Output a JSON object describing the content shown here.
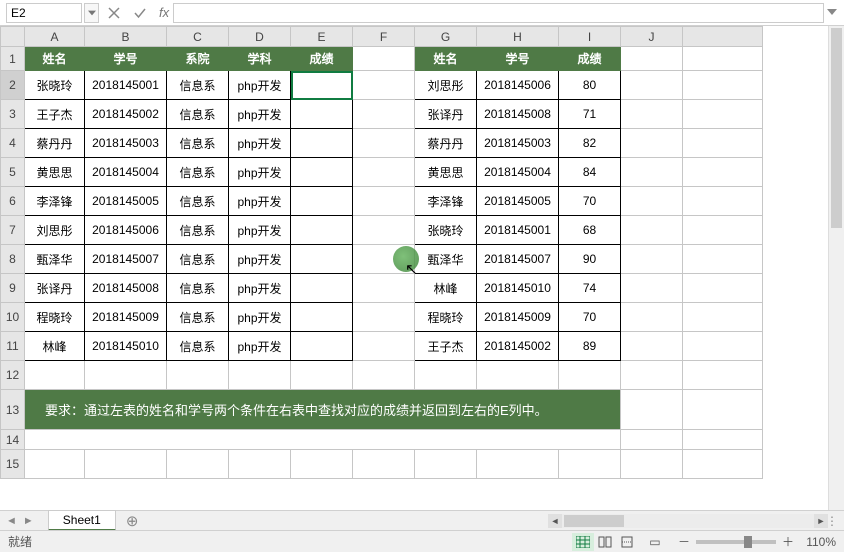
{
  "namebox": {
    "value": "E2"
  },
  "formula_bar": {
    "value": ""
  },
  "columns": [
    "A",
    "B",
    "C",
    "D",
    "E",
    "F",
    "G",
    "H",
    "I",
    "J"
  ],
  "row_nums": [
    1,
    2,
    3,
    4,
    5,
    6,
    7,
    8,
    9,
    10,
    11,
    12,
    13,
    14,
    15
  ],
  "left": {
    "headers": {
      "name": "姓名",
      "sid": "学号",
      "dept": "系院",
      "subject": "学科",
      "score": "成绩"
    },
    "rows": [
      {
        "name": "张晓玲",
        "sid": "2018145001",
        "dept": "信息系",
        "subject": "php开发",
        "score": ""
      },
      {
        "name": "王子杰",
        "sid": "2018145002",
        "dept": "信息系",
        "subject": "php开发",
        "score": ""
      },
      {
        "name": "蔡丹丹",
        "sid": "2018145003",
        "dept": "信息系",
        "subject": "php开发",
        "score": ""
      },
      {
        "name": "黄思思",
        "sid": "2018145004",
        "dept": "信息系",
        "subject": "php开发",
        "score": ""
      },
      {
        "name": "李泽锋",
        "sid": "2018145005",
        "dept": "信息系",
        "subject": "php开发",
        "score": ""
      },
      {
        "name": "刘思彤",
        "sid": "2018145006",
        "dept": "信息系",
        "subject": "php开发",
        "score": ""
      },
      {
        "name": "甄泽华",
        "sid": "2018145007",
        "dept": "信息系",
        "subject": "php开发",
        "score": ""
      },
      {
        "name": "张译丹",
        "sid": "2018145008",
        "dept": "信息系",
        "subject": "php开发",
        "score": ""
      },
      {
        "name": "程晓玲",
        "sid": "2018145009",
        "dept": "信息系",
        "subject": "php开发",
        "score": ""
      },
      {
        "name": "林峰",
        "sid": "2018145010",
        "dept": "信息系",
        "subject": "php开发",
        "score": ""
      }
    ]
  },
  "right": {
    "headers": {
      "name": "姓名",
      "sid": "学号",
      "score": "成绩"
    },
    "rows": [
      {
        "name": "刘思彤",
        "sid": "2018145006",
        "score": "80"
      },
      {
        "name": "张译丹",
        "sid": "2018145008",
        "score": "71"
      },
      {
        "name": "蔡丹丹",
        "sid": "2018145003",
        "score": "82"
      },
      {
        "name": "黄思思",
        "sid": "2018145004",
        "score": "84"
      },
      {
        "name": "李泽锋",
        "sid": "2018145005",
        "score": "70"
      },
      {
        "name": "张晓玲",
        "sid": "2018145001",
        "score": "68"
      },
      {
        "name": "甄泽华",
        "sid": "2018145007",
        "score": "90"
      },
      {
        "name": "林峰",
        "sid": "2018145010",
        "score": "74"
      },
      {
        "name": "程晓玲",
        "sid": "2018145009",
        "score": "70"
      },
      {
        "name": "王子杰",
        "sid": "2018145002",
        "score": "89"
      }
    ]
  },
  "instruction": "要求：通过左表的姓名和学号两个条件在右表中查找对应的成绩并返回到左右的E列中。",
  "tab": {
    "name": "Sheet1"
  },
  "status": {
    "text": "就绪"
  },
  "zoom": {
    "label": "110%"
  }
}
